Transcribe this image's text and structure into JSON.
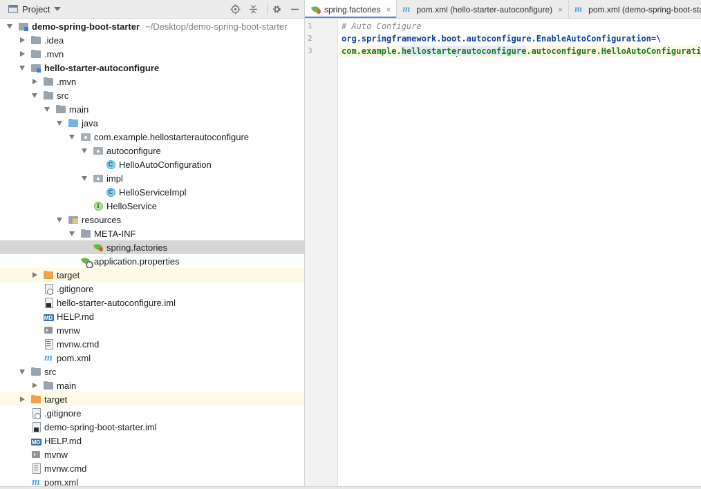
{
  "project_panel": {
    "title": "Project",
    "tree": [
      {
        "label": "demo-spring-boot-starter",
        "path": "~/Desktop/demo-spring-boot-starter",
        "icon": "module",
        "arrow": "open",
        "depth": 0,
        "bold": true
      },
      {
        "label": ".idea",
        "icon": "folder",
        "arrow": "closed",
        "depth": 1
      },
      {
        "label": ".mvn",
        "icon": "folder",
        "arrow": "closed",
        "depth": 1
      },
      {
        "label": "hello-starter-autoconfigure",
        "icon": "module",
        "arrow": "open",
        "depth": 1,
        "bold": true
      },
      {
        "label": ".mvn",
        "icon": "folder",
        "arrow": "closed",
        "depth": 2
      },
      {
        "label": "src",
        "icon": "folder",
        "arrow": "open",
        "depth": 2
      },
      {
        "label": "main",
        "icon": "folder",
        "arrow": "open",
        "depth": 3
      },
      {
        "label": "java",
        "icon": "folder-blue",
        "arrow": "open",
        "depth": 4
      },
      {
        "label": "com.example.hellostarterautoconfigure",
        "icon": "package",
        "arrow": "open",
        "depth": 5
      },
      {
        "label": "autoconfigure",
        "icon": "package",
        "arrow": "open",
        "depth": 6
      },
      {
        "label": "HelloAutoConfiguration",
        "icon": "class",
        "arrow": "none",
        "depth": 7
      },
      {
        "label": "impl",
        "icon": "package",
        "arrow": "open",
        "depth": 6
      },
      {
        "label": "HelloServiceImpl",
        "icon": "class",
        "arrow": "none",
        "depth": 7
      },
      {
        "label": "HelloService",
        "icon": "interface",
        "arrow": "none",
        "depth": 6
      },
      {
        "label": "resources",
        "icon": "resources",
        "arrow": "open",
        "depth": 4
      },
      {
        "label": "META-INF",
        "icon": "folder",
        "arrow": "open",
        "depth": 5
      },
      {
        "label": "spring.factories",
        "icon": "spring-leaf",
        "arrow": "none",
        "depth": 6,
        "selected": true
      },
      {
        "label": "application.properties",
        "icon": "spring-properties",
        "arrow": "none",
        "depth": 5
      },
      {
        "label": "target",
        "icon": "folder-orange",
        "arrow": "closed",
        "depth": 2,
        "excluded": true
      },
      {
        "label": ".gitignore",
        "icon": "gitignore",
        "arrow": "none",
        "depth": 2
      },
      {
        "label": "hello-starter-autoconfigure.iml",
        "icon": "iml",
        "arrow": "none",
        "depth": 2
      },
      {
        "label": "HELP.md",
        "icon": "markdown",
        "arrow": "none",
        "depth": 2
      },
      {
        "label": "mvnw",
        "icon": "terminal",
        "arrow": "none",
        "depth": 2
      },
      {
        "label": "mvnw.cmd",
        "icon": "cmd-file",
        "arrow": "none",
        "depth": 2
      },
      {
        "label": "pom.xml",
        "icon": "maven",
        "arrow": "none",
        "depth": 2
      },
      {
        "label": "src",
        "icon": "folder",
        "arrow": "open",
        "depth": 1
      },
      {
        "label": "main",
        "icon": "folder",
        "arrow": "closed",
        "depth": 2
      },
      {
        "label": "target",
        "icon": "folder-orange",
        "arrow": "closed",
        "depth": 1,
        "excluded": true
      },
      {
        "label": ".gitignore",
        "icon": "gitignore",
        "arrow": "none",
        "depth": 1
      },
      {
        "label": "demo-spring-boot-starter.iml",
        "icon": "iml",
        "arrow": "none",
        "depth": 1
      },
      {
        "label": "HELP.md",
        "icon": "markdown",
        "arrow": "none",
        "depth": 1
      },
      {
        "label": "mvnw",
        "icon": "terminal",
        "arrow": "none",
        "depth": 1
      },
      {
        "label": "mvnw.cmd",
        "icon": "cmd-file",
        "arrow": "none",
        "depth": 1
      },
      {
        "label": "pom.xml",
        "icon": "maven",
        "arrow": "none",
        "depth": 1
      }
    ]
  },
  "editor": {
    "tabs": [
      {
        "label": "spring.factories",
        "icon": "spring-leaf",
        "active": true,
        "close": "×"
      },
      {
        "label": "pom.xml (hello-starter-autoconfigure)",
        "icon": "maven",
        "active": false,
        "close": "×"
      },
      {
        "label": "pom.xml (demo-spring-boot-starter)",
        "icon": "maven",
        "active": false,
        "close": ""
      }
    ],
    "line_numbers": [
      "1",
      "2",
      "3"
    ],
    "lines": {
      "comment": "# Auto Configure",
      "key": "org.springframework.boot.autoconfigure.EnableAutoConfiguration=\\",
      "v_pre": "com.example.",
      "v_hl_a": "hellostarte",
      "v_hl_b": "rautoconfigure",
      "v_post": ".autoconfigure.HelloAutoConfiguration"
    }
  },
  "colors": {
    "selection": "#d5d5d5",
    "excluded": "#fdfbe5",
    "current_line": "#fcfae6",
    "key": "#0b3fa0",
    "value": "#1a7a1a",
    "comment": "#8c8c8c"
  }
}
